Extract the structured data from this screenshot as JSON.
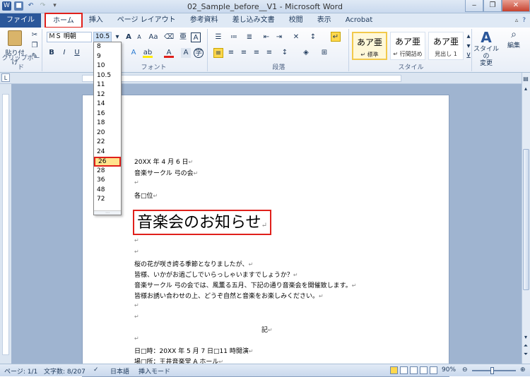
{
  "window": {
    "title": "02_Sample_before__V1 - Microsoft Word"
  },
  "tabs": [
    {
      "label": "ファイル"
    },
    {
      "label": "ホーム"
    },
    {
      "label": "挿入"
    },
    {
      "label": "ページ レイアウト"
    },
    {
      "label": "参考資料"
    },
    {
      "label": "差し込み文書"
    },
    {
      "label": "校閲"
    },
    {
      "label": "表示"
    },
    {
      "label": "Acrobat"
    }
  ],
  "ribbon": {
    "clipboard": {
      "paste_label": "貼り付け",
      "group_label": "クリップボード"
    },
    "font": {
      "font_name": "ＭＳ 明朝",
      "font_size": "10.5",
      "group_label": "フォント"
    },
    "paragraph": {
      "group_label": "段落"
    },
    "styles": {
      "group_label": "スタイル",
      "items": [
        {
          "preview": "あア亜",
          "name": "↵ 標準"
        },
        {
          "preview": "あア亜",
          "name": "↵ 行間詰め"
        },
        {
          "preview": "あア亜",
          "name": "見出し 1"
        }
      ],
      "change_styles_label": "スタイルの\n変更",
      "edit_label": "編集"
    }
  },
  "font_size_dropdown": {
    "options": [
      "8",
      "9",
      "10",
      "10.5",
      "11",
      "12",
      "14",
      "16",
      "18",
      "20",
      "22",
      "24",
      "26",
      "28",
      "36",
      "48",
      "72"
    ],
    "highlighted": "26"
  },
  "document": {
    "lines": [
      {
        "text": "20XX 年 4 月 6 日",
        "mark": "↵"
      },
      {
        "text": "音楽サークル 弓の会",
        "mark": "↵"
      },
      {
        "text": "",
        "mark": "↵"
      },
      {
        "text": "各□位",
        "mark": "↵"
      }
    ],
    "heading": {
      "text": "音楽会のお知らせ",
      "mark": "↵"
    },
    "body": [
      {
        "text": "",
        "mark": "↵"
      },
      {
        "text": "",
        "mark": "↵"
      },
      {
        "text": "桜の花が咲き誇る季節となりましたが、",
        "mark": "↵"
      },
      {
        "text": "皆様、いかがお過ごしでいらっしゃいますでしょうか？",
        "mark": "↵"
      },
      {
        "text": "音楽サークル 弓の会では、風薫る五月、下記の通り音楽会を開催致します。",
        "mark": "↵"
      },
      {
        "text": "皆様お誘い合わせの上、どうぞ自然と音楽をお楽しみください。",
        "mark": "↵"
      },
      {
        "text": "",
        "mark": "↵"
      },
      {
        "text": "",
        "mark": "↵"
      }
    ],
    "ki": {
      "text": "記",
      "mark": "↵"
    },
    "tail": [
      {
        "text": "",
        "mark": "↵"
      },
      {
        "text": "日□時：20XX 年 5 月 7 日□11 時開演",
        "mark": "↵"
      },
      {
        "text": "場□所：王井音楽堂 A ホール",
        "mark": "↵"
      }
    ]
  },
  "status": {
    "page": "ページ: 1/1",
    "words": "文字数: 8/207",
    "language": "日本語",
    "mode": "挿入モード",
    "zoom": "90%"
  },
  "colors": {
    "file_tab": "#2b579a",
    "highlight_box": "#e0201b",
    "dropdown_highlight": "#ffe38d"
  }
}
